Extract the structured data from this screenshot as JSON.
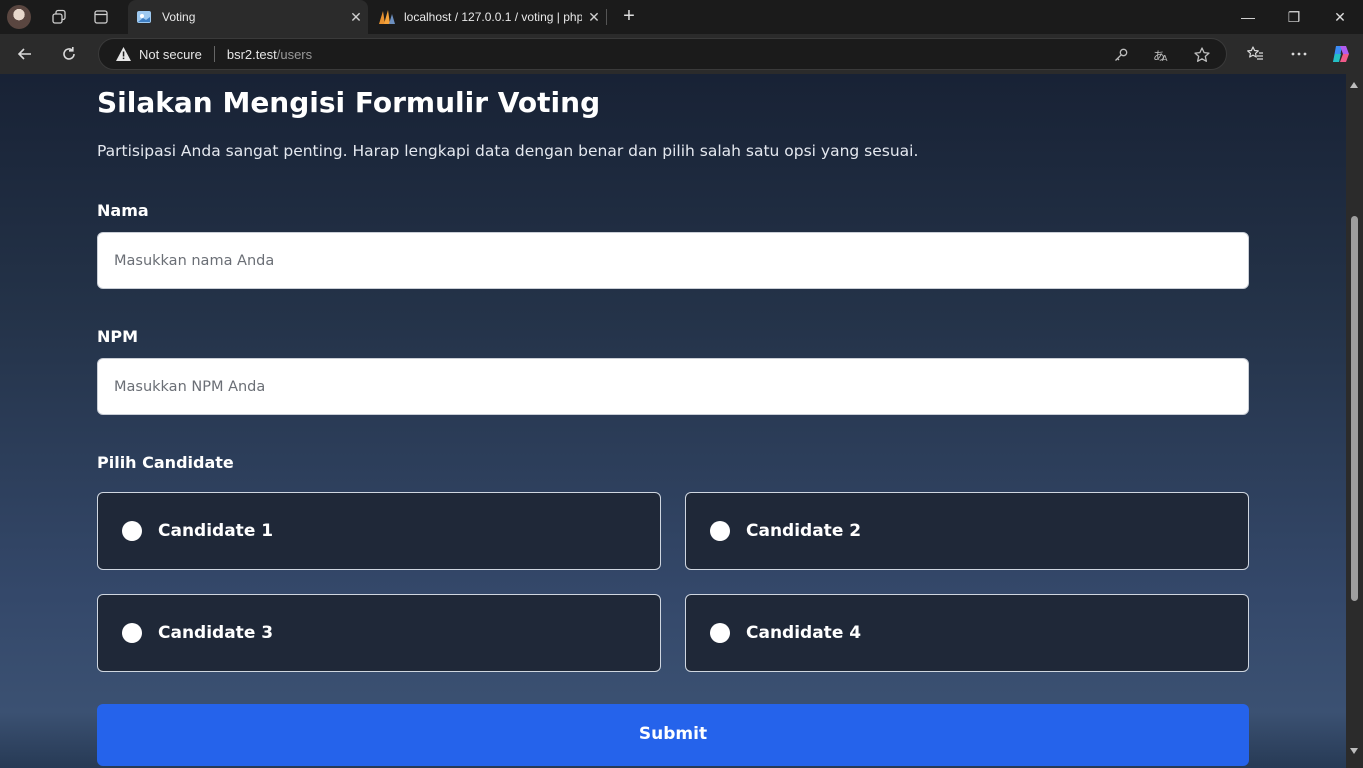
{
  "browser": {
    "tabs": [
      {
        "label": "Voting",
        "active": true
      },
      {
        "label": "localhost / 127.0.0.1 / voting | php",
        "active": false
      }
    ],
    "address": {
      "security_label": "Not secure",
      "host": "bsr2.test",
      "path": "/users"
    },
    "window_controls": {
      "minimize": "—",
      "restore": "❐",
      "close": "✕"
    }
  },
  "page": {
    "title": "Silakan Mengisi Formulir Voting",
    "subtitle": "Partisipasi Anda sangat penting. Harap lengkapi data dengan benar dan pilih salah satu opsi yang sesuai.",
    "name_field": {
      "label": "Nama",
      "placeholder": "Masukkan nama Anda",
      "value": ""
    },
    "npm_field": {
      "label": "NPM",
      "placeholder": "Masukkan NPM Anda",
      "value": ""
    },
    "candidate_label": "Pilih Candidate",
    "candidates": [
      "Candidate 1",
      "Candidate 2",
      "Candidate 3",
      "Candidate 4"
    ],
    "submit_label": "Submit"
  },
  "colors": {
    "accent": "#2563eb",
    "card_bg": "#1f2838",
    "page_bg_top": "#182235",
    "page_bg_bottom": "#3b5172"
  }
}
